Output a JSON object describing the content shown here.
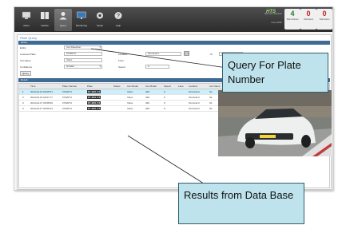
{
  "toolbar": {
    "buttons": [
      {
        "label": "Alerts",
        "icon": "monitor-icon",
        "name": "toolbar-alerts"
      },
      {
        "label": "Vehicle",
        "icon": "book-icon",
        "name": "toolbar-vehicle"
      },
      {
        "label": "Query",
        "icon": "person-icon",
        "name": "toolbar-query"
      },
      {
        "label": "Monitoring",
        "icon": "display-icon",
        "name": "toolbar-monitoring"
      },
      {
        "label": "Setup",
        "icon": "gear-icon",
        "name": "toolbar-setup"
      },
      {
        "label": "Help",
        "icon": "help-icon",
        "name": "toolbar-help"
      }
    ],
    "brand": {
      "logo": "HTS",
      "subtitle": "High-Tech Solutions",
      "user": "User: admin"
    },
    "counters": [
      {
        "value": "4",
        "label": "Total Vehicles",
        "color": "#2a7a2a"
      },
      {
        "value": "0",
        "label": "Total Alerts",
        "color": "#c02020"
      },
      {
        "value": "0",
        "label": "Total Stolen",
        "color": "#c02020"
      }
    ]
  },
  "panel": {
    "title": "Plate Query",
    "query_section": {
      "header": "Query",
      "entity_label": "Entity",
      "entity_value": "Car Detection",
      "licensed_plate_label": "Licensed Plate",
      "licensed_plate_value": "2732074",
      "car_name_label": "Car Name",
      "car_name_value": "Volvo",
      "confidence_label": "Confidence",
      "confidence_value": "Greater",
      "location_label": "Location",
      "location_value": "Terminal 2",
      "from_label": "From",
      "date_value": "2014-04-01 00:00",
      "to_label": "To",
      "speed_label": "Speed",
      "speed_value": "0",
      "query_button": "Query"
    },
    "results_section": {
      "header": "Result",
      "columns": [
        "",
        "Time",
        "Plate Number",
        "Plate",
        "Status",
        "Car Model",
        "Car Model",
        "Speed",
        "Lane",
        "Location",
        "Car Name"
      ],
      "rows": [
        {
          "index": "1",
          "time": "2014-04-16 09:05:51",
          "number": "2732074",
          "plate": "27-320-74",
          "make": "Volvo",
          "code": "320",
          "speed": "0",
          "location": "Terminal 2",
          "name": "S1"
        },
        {
          "index": "2",
          "time": "2014-04-16 09:07:17",
          "number": "2732074",
          "plate": "27-320-74",
          "make": "Volvo",
          "code": "320",
          "speed": "0",
          "location": "Terminal 2",
          "name": "S1"
        },
        {
          "index": "3",
          "time": "2014-04-17 09:58:09",
          "number": "2732074",
          "plate": "27-320-74",
          "make": "Volvo",
          "code": "320",
          "speed": "0",
          "location": "Terminal 2",
          "name": "S1"
        },
        {
          "index": "4",
          "time": "2014-04-17 09:59:44",
          "number": "2732074",
          "plate": "27-320-74",
          "make": "Volvo",
          "code": "320",
          "speed": "0",
          "location": "Terminal 2",
          "name": "S1"
        }
      ]
    }
  },
  "callouts": {
    "query": "Query For Plate Number",
    "results": "Results from Data Base"
  },
  "colors": {
    "toolbar_dark": "#2b2b2b",
    "section_header": "#3f6a94",
    "selected_row": "#cdeefa",
    "callout_fill": "#bfe3ec",
    "brand_green": "#9be07a"
  }
}
